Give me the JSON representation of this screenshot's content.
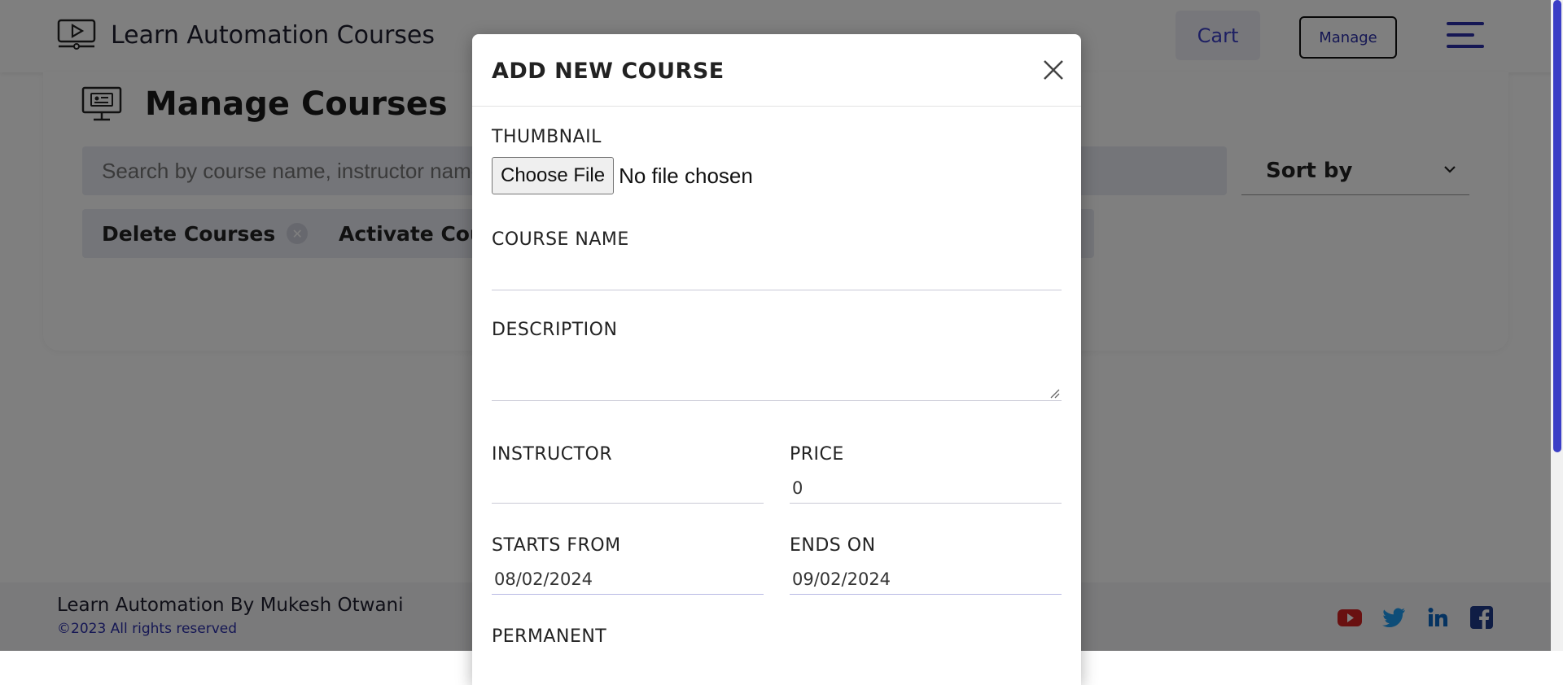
{
  "navbar": {
    "brand_title": "Learn Automation Courses",
    "cart_label": "Cart",
    "manage_label": "Manage"
  },
  "page": {
    "heading": "Manage Courses",
    "search_placeholder": "Search by course name, instructor name",
    "sort_label": "Sort by",
    "chips": [
      {
        "label": "Delete Courses"
      },
      {
        "label": "Activate Courses"
      }
    ]
  },
  "footer": {
    "line1": "Learn Automation By Mukesh Otwani",
    "line2": "©2023 All rights reserved",
    "social": [
      "youtube-icon",
      "twitter-icon",
      "linkedin-icon",
      "facebook-icon"
    ]
  },
  "modal": {
    "title": "ADD NEW COURSE",
    "thumbnail_label": "THUMBNAIL",
    "file_button": "Choose File",
    "file_status": "No file chosen",
    "course_name_label": "COURSE NAME",
    "course_name_value": "",
    "description_label": "DESCRIPTION",
    "instructor_label": "INSTRUCTOR",
    "instructor_value": "",
    "price_label": "PRICE",
    "price_value": "0",
    "starts_label": "STARTS FROM",
    "starts_value": "08/02/2024",
    "ends_label": "ENDS ON",
    "ends_value": "09/02/2024",
    "permanent_label": "PERMANENT"
  },
  "colors": {
    "accent": "#3b3ec6",
    "overlay": "rgba(0,0,0,0.5)",
    "youtube": "#d32020",
    "twitter": "#1d9bf0",
    "linkedin": "#0a66c2",
    "facebook": "#1e3a8a"
  }
}
